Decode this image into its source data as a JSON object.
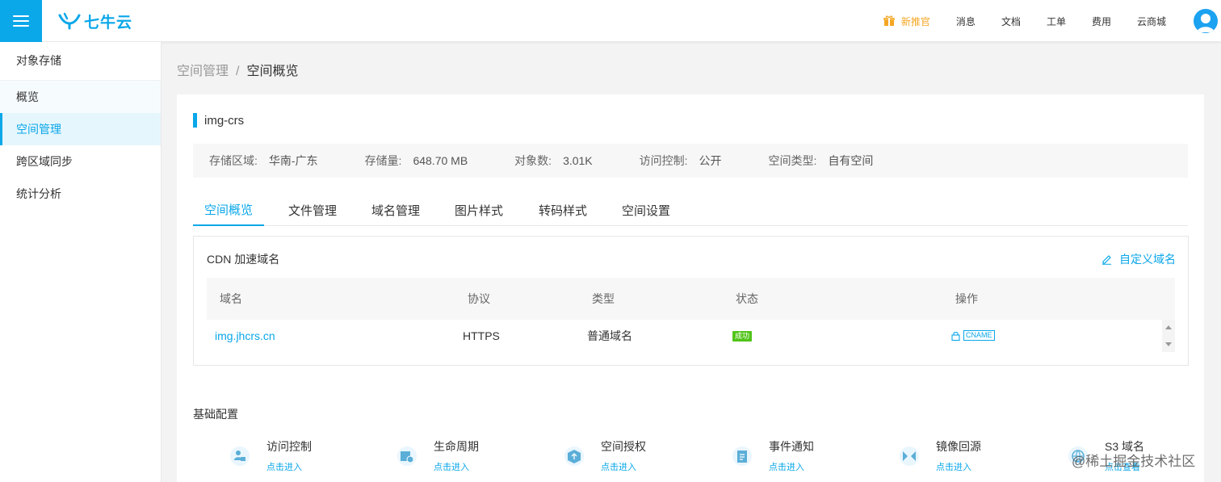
{
  "header": {
    "logo_text": "七牛云",
    "nav": [
      {
        "label": "新推官",
        "promo": true
      },
      {
        "label": "消息"
      },
      {
        "label": "文档"
      },
      {
        "label": "工单"
      },
      {
        "label": "费用"
      },
      {
        "label": "云商城"
      }
    ],
    "accent_color": "#0aa7e9",
    "promo_color": "#f5a623"
  },
  "sidebar": {
    "title": "对象存储",
    "items": [
      {
        "label": "概览"
      },
      {
        "label": "空间管理",
        "active": true
      },
      {
        "label": "跨区域同步"
      },
      {
        "label": "统计分析"
      }
    ]
  },
  "breadcrumb": {
    "parent": "空间管理",
    "separator": "/",
    "current": "空间概览"
  },
  "bucket": {
    "name": "img-crs",
    "info": [
      {
        "label": "存储区域:",
        "value": "华南-广东"
      },
      {
        "label": "存储量:",
        "value": "648.70 MB"
      },
      {
        "label": "对象数:",
        "value": "3.01K"
      },
      {
        "label": "访问控制:",
        "value": "公开"
      },
      {
        "label": "空间类型:",
        "value": "自有空间"
      }
    ]
  },
  "tabs": [
    {
      "label": "空间概览",
      "active": true
    },
    {
      "label": "文件管理"
    },
    {
      "label": "域名管理"
    },
    {
      "label": "图片样式"
    },
    {
      "label": "转码样式"
    },
    {
      "label": "空间设置"
    }
  ],
  "cdn": {
    "title": "CDN 加速域名",
    "custom_domain_label": "自定义域名",
    "columns": [
      "域名",
      "协议",
      "类型",
      "状态",
      "操作"
    ],
    "rows": [
      {
        "domain": "img.jhcrs.cn",
        "protocol": "HTTPS",
        "type": "普通域名",
        "status": "成功",
        "action": "CNAME"
      }
    ]
  },
  "basic_config": {
    "title": "基础配置",
    "items": [
      {
        "name": "访问控制",
        "link": "点击进入",
        "icon": "access-control-icon"
      },
      {
        "name": "生命周期",
        "link": "点击进入",
        "icon": "lifecycle-icon"
      },
      {
        "name": "空间授权",
        "link": "点击进入",
        "icon": "authorization-icon"
      },
      {
        "name": "事件通知",
        "link": "点击进入",
        "icon": "event-notification-icon"
      },
      {
        "name": "镜像回源",
        "link": "点击进入",
        "icon": "mirror-source-icon"
      },
      {
        "name": "S3 域名",
        "link": "点击查看",
        "icon": "s3-domain-icon"
      }
    ]
  },
  "watermark": {
    "text": "@稀土掘金技术社区"
  }
}
